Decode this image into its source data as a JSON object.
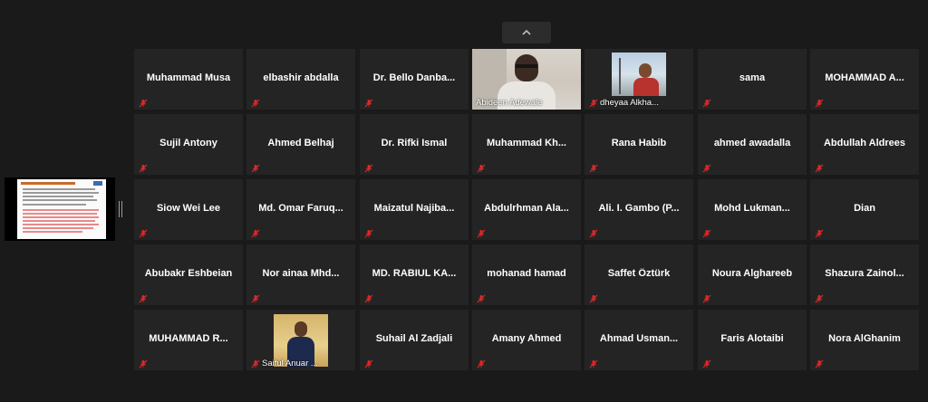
{
  "navigation": {
    "scroll_up_icon": "chevron-up-icon"
  },
  "shared_screen": {
    "label": "Shared screen thumbnail"
  },
  "mute_icon": "mic-off-icon",
  "colors": {
    "tile_bg": "#242424",
    "stage_bg": "#1a1a1a",
    "muted_red": "#e02828"
  },
  "participants": [
    {
      "name": "Muhammad Musa",
      "video": false,
      "muted": true
    },
    {
      "name": "elbashir abdalla",
      "video": false,
      "muted": true
    },
    {
      "name": "Dr. Bello  Danba...",
      "video": false,
      "muted": true
    },
    {
      "name": "Abideen Adewale",
      "video": true,
      "muted": false
    },
    {
      "name": "dheyaa Alkha...",
      "video": true,
      "muted": true
    },
    {
      "name": "sama",
      "video": false,
      "muted": true
    },
    {
      "name": "MOHAMMAD  A...",
      "video": false,
      "muted": true
    },
    {
      "name": "Sujil Antony",
      "video": false,
      "muted": true
    },
    {
      "name": "Ahmed Belhaj",
      "video": false,
      "muted": true
    },
    {
      "name": "Dr. Rifki Ismal",
      "video": false,
      "muted": true
    },
    {
      "name": "Muhammad  Kh...",
      "video": false,
      "muted": true
    },
    {
      "name": "Rana Habib",
      "video": false,
      "muted": true
    },
    {
      "name": "ahmed awadalla",
      "video": false,
      "muted": true
    },
    {
      "name": "Abdullah Aldrees",
      "video": false,
      "muted": true
    },
    {
      "name": "Siow Wei Lee",
      "video": false,
      "muted": true
    },
    {
      "name": "Md. Omar  Faruq...",
      "video": false,
      "muted": true
    },
    {
      "name": "Maizatul  Najiba...",
      "video": false,
      "muted": true
    },
    {
      "name": "Abdulrhman  Ala...",
      "video": false,
      "muted": true
    },
    {
      "name": "Ali. I. Gambo (P...",
      "video": false,
      "muted": true
    },
    {
      "name": "Mohd  Lukman...",
      "video": false,
      "muted": true
    },
    {
      "name": "Dian",
      "video": false,
      "muted": true
    },
    {
      "name": "Abubakr Eshbeian",
      "video": false,
      "muted": true
    },
    {
      "name": "Nor ainaa  Mhd...",
      "video": false,
      "muted": true
    },
    {
      "name": "MD. RABIUL  KA...",
      "video": false,
      "muted": true
    },
    {
      "name": "mohanad hamad",
      "video": false,
      "muted": true
    },
    {
      "name": "Saffet Öztürk",
      "video": false,
      "muted": true
    },
    {
      "name": "Noura Alghareeb",
      "video": false,
      "muted": true
    },
    {
      "name": "Shazura  Zainol...",
      "video": false,
      "muted": true
    },
    {
      "name": "MUHAMMAD  R...",
      "video": false,
      "muted": true
    },
    {
      "name": "Saiful Anuar ...",
      "video": true,
      "muted": true
    },
    {
      "name": "Suhail Al Zadjali",
      "video": false,
      "muted": true
    },
    {
      "name": "Amany Ahmed",
      "video": false,
      "muted": true
    },
    {
      "name": "Ahmad  Usman...",
      "video": false,
      "muted": true
    },
    {
      "name": "Faris Alotaibi",
      "video": false,
      "muted": true
    },
    {
      "name": "Nora AlGhanim",
      "video": false,
      "muted": true
    }
  ]
}
